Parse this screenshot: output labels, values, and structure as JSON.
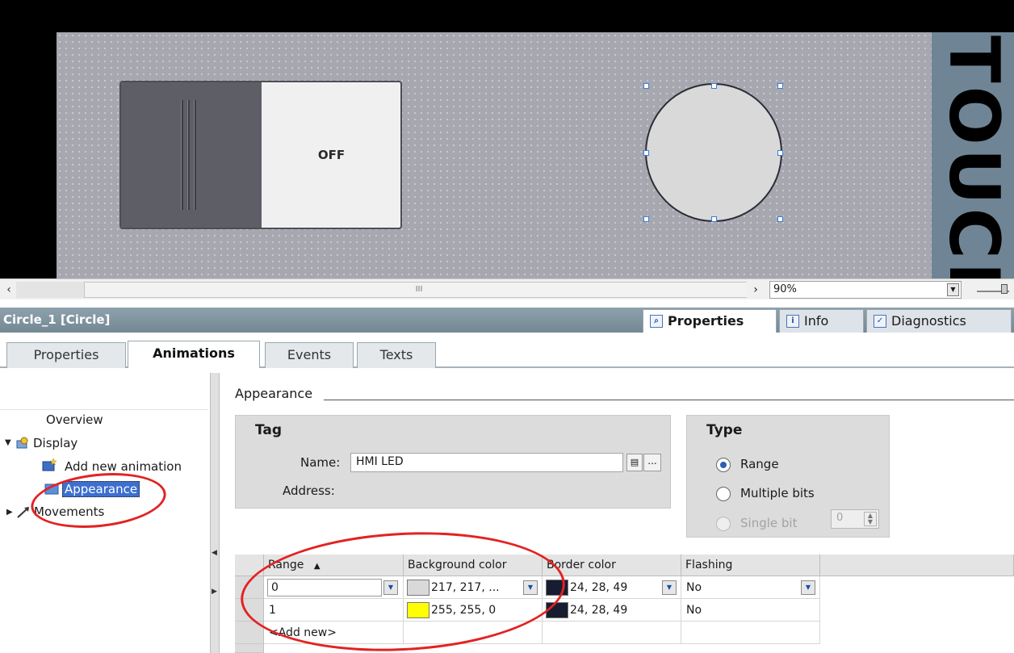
{
  "canvas": {
    "switch_label": "OFF",
    "side_text": "TOUCH"
  },
  "scrollbar": {
    "left_arrow": "‹",
    "right_arrow": "›",
    "thumb_grip": "III",
    "zoom_value": "90%",
    "zoom_dropdown": "▼"
  },
  "inspector": {
    "object_title": "Circle_1 [Circle]",
    "top_tabs": [
      {
        "label": "Properties",
        "icon": "properties-icon",
        "glyph": "🔍"
      },
      {
        "label": "Info",
        "icon": "info-icon",
        "glyph": "i"
      },
      {
        "label": "Diagnostics",
        "icon": "diagnostics-icon",
        "glyph": "✓"
      }
    ],
    "sub_tabs": [
      {
        "label": "Properties"
      },
      {
        "label": "Animations"
      },
      {
        "label": "Events"
      },
      {
        "label": "Texts"
      }
    ],
    "active_sub_tab": "Animations"
  },
  "nav": {
    "overview": "Overview",
    "display": "Display",
    "add_new_animation": "Add new animation",
    "appearance": "Appearance",
    "movements": "Movements"
  },
  "appearance": {
    "section_title": "Appearance",
    "tag": {
      "title": "Tag",
      "name_label": "Name:",
      "name_value": "HMI LED",
      "browse_label": "...",
      "address_label": "Address:"
    },
    "type": {
      "title": "Type",
      "options": [
        {
          "label": "Range",
          "checked": true,
          "disabled": false
        },
        {
          "label": "Multiple bits",
          "checked": false,
          "disabled": false
        },
        {
          "label": "Single bit",
          "checked": false,
          "disabled": true
        }
      ],
      "bit_value": "0"
    },
    "table": {
      "columns": [
        "Range",
        "Background color",
        "Border color",
        "Flashing"
      ],
      "sort_indicator": "▲",
      "rows": [
        {
          "range": "0",
          "background_color": "217, 217, ...",
          "background_hex": "#d9d9d9",
          "border_color": "24, 28, 49",
          "border_hex": "#181c31",
          "flashing": "No"
        },
        {
          "range": "1",
          "background_color": "255, 255, 0",
          "background_hex": "#ffff00",
          "border_color": "24, 28, 49",
          "border_hex": "#181c31",
          "flashing": "No"
        }
      ],
      "add_new": "<Add new>"
    }
  },
  "colors": {
    "annotation": "#e32222",
    "title_bar": "#7d909c",
    "selection": "#3d7bd6"
  }
}
